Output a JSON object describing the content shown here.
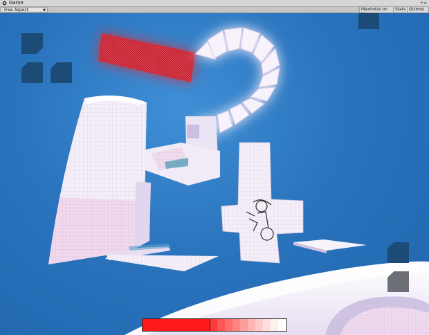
{
  "window": {
    "title": "Game",
    "controls": "+≡"
  },
  "toolbar": {
    "aspect_value": "Free Aspect",
    "maximize_label": "Maximize on Play",
    "stats_label": "Stats",
    "gizmos_label": "Gizmos"
  },
  "hud": {
    "health_fraction": 0.47,
    "health_color": "#ff1a1a"
  },
  "colors": {
    "sky": "#2a74bd",
    "hud_square": "#1d4b78",
    "hud_square_gray": "#6c6f75"
  },
  "icons": [
    "unity-game-icon",
    "dropdown-arrow-icon"
  ]
}
